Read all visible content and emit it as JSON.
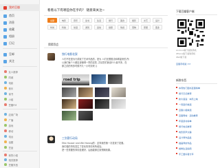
{
  "sidebar": {
    "items": [
      {
        "label": "我的豆瓣",
        "icon": "home-icon",
        "color": "#e33c2e"
      },
      {
        "label": "首页",
        "icon": "house-icon",
        "color": "#5aa5e6"
      },
      {
        "label": "消息",
        "icon": "message-icon",
        "color": "#5aa5e6"
      },
      {
        "label": "收藏",
        "icon": "star-icon",
        "color": "#5aa5e6"
      },
      {
        "label": "相册",
        "icon": "photo-icon",
        "color": "#5aa5e6"
      },
      {
        "label": "日记",
        "icon": "diary-icon",
        "color": "#5aa5e6"
      },
      {
        "label": "豆邮",
        "icon": "mail-icon",
        "color": "#5aa5e6"
      },
      {
        "label": "关注",
        "icon": "follow-icon",
        "color": "#5aa5e6"
      }
    ],
    "group1": [
      "友人推荐",
      "同城",
      "电影",
      "音乐",
      "读书",
      "小组",
      "豆瓣FM"
    ],
    "group2": [
      "应用广场",
      "广播",
      "游戏",
      "移动",
      "电台",
      "话题",
      "豆品"
    ],
    "group3": [
      "我的小组",
      "相关推荐",
      "豆瓣东西",
      "发现"
    ]
  },
  "main": {
    "title": "看看以下有哪些你在乎的？ 随意来关注~",
    "tabs": [
      {
        "label": "全部",
        "selected": true
      },
      {
        "label": "电影"
      },
      {
        "label": "音乐"
      },
      {
        "label": "读书"
      },
      {
        "label": "生活"
      },
      {
        "label": "旅行"
      },
      {
        "label": "美食"
      },
      {
        "label": "摄影"
      },
      {
        "label": "文艺"
      },
      {
        "label": "设计"
      },
      {
        "label": "时尚"
      },
      {
        "label": "科技"
      },
      {
        "label": "动漫"
      },
      {
        "label": "游戏"
      },
      {
        "label": "运动"
      },
      {
        "label": "健康"
      },
      {
        "label": "情感"
      },
      {
        "label": "宠物"
      },
      {
        "label": "家居"
      },
      {
        "label": "更多"
      }
    ],
    "section_title": "猜猜我会",
    "post1": {
      "user": "独行电影花絮",
      "text_line1": "人们不在是为行成就了艺术作品的，是为 人们无限想法和希望来的,所",
      "text_line2": "以我们每个人都应该懂得一样的这些, 并请您们我该什么最不多，在",
      "text_line3": "那之前的有多时候不久一小时到来 ()"
    },
    "post2": {
      "user": "三剑客行动局",
      "text_line1": "Etta Houser and Wei Hwang的：这事我的第一次发现了发展。",
      "text_line2": "我们做的事情发生了变化的事情有所增加。",
      "text_line3": "把一些重要的事情处理好，后面能够达到预期效果。"
    },
    "photo_caption": "road trip"
  },
  "right": {
    "qr_title": "下载豆瓣客户端",
    "small1": "Android版下载到手机",
    "small2": "iPhone版下载到手机",
    "small3": "iPad版下载",
    "recommend_title": "豆瓣手机版 >>",
    "news_title": "新鲜东西",
    "news": [
      "本周热门图书豆瓣榜单",
      "旅行日记推荐",
      "新片速递 · 本周上映",
      "一周音乐精选",
      "豆瓣小组精选",
      "豆瓣同城 · 活动推荐",
      "年度读书榜单",
      "旅行地点推荐",
      "电影原声大碟",
      "设计师作品集",
      "插画师的作品",
      "咖啡生活指南",
      "手工爱好者分享"
    ]
  },
  "colors": {
    "accent": "#e33c2e",
    "link": "#2d6bb5",
    "tab_selected": "#f07e1a"
  }
}
